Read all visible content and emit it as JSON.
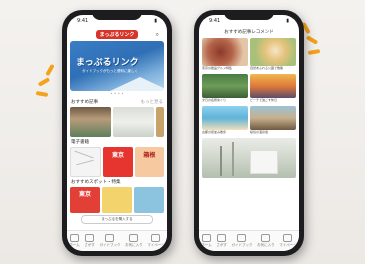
{
  "left_phone": {
    "status_time": "9:41",
    "logo_text": "まっぷるリンク",
    "banner": {
      "title": "まっぷるリンク",
      "subtitle": "ガイドブックがもっと便利に楽しく"
    },
    "section_recent": {
      "label": "おすすめ記事",
      "more": "もっと見る"
    },
    "section_guides": {
      "label": "電子書籍"
    },
    "book_covers": [
      "東京",
      "箱根",
      "東京"
    ],
    "section_third": {
      "label": "おすすめスポット・特集"
    },
    "bottom_button": "まっぷるを購入する"
  },
  "right_phone": {
    "status_time": "9:41",
    "header_title": "おすすめ記事レコメンド",
    "card_captions": [
      "東京の絶品グルメ特集",
      "自然あふれる公園で散策",
      "夕日の名所めぐり",
      "ビーチで過ごす休日",
      "古都の街並み散歩",
      "秘境の温泉宿"
    ]
  },
  "tabbar": [
    "ホーム",
    "さがす",
    "ガイドブック",
    "お気に入り",
    "マイページ"
  ],
  "colors": {
    "accent": "#f3a21c",
    "banner_blue": "#2f6fb5",
    "phone_body": "#1d1d1f"
  }
}
